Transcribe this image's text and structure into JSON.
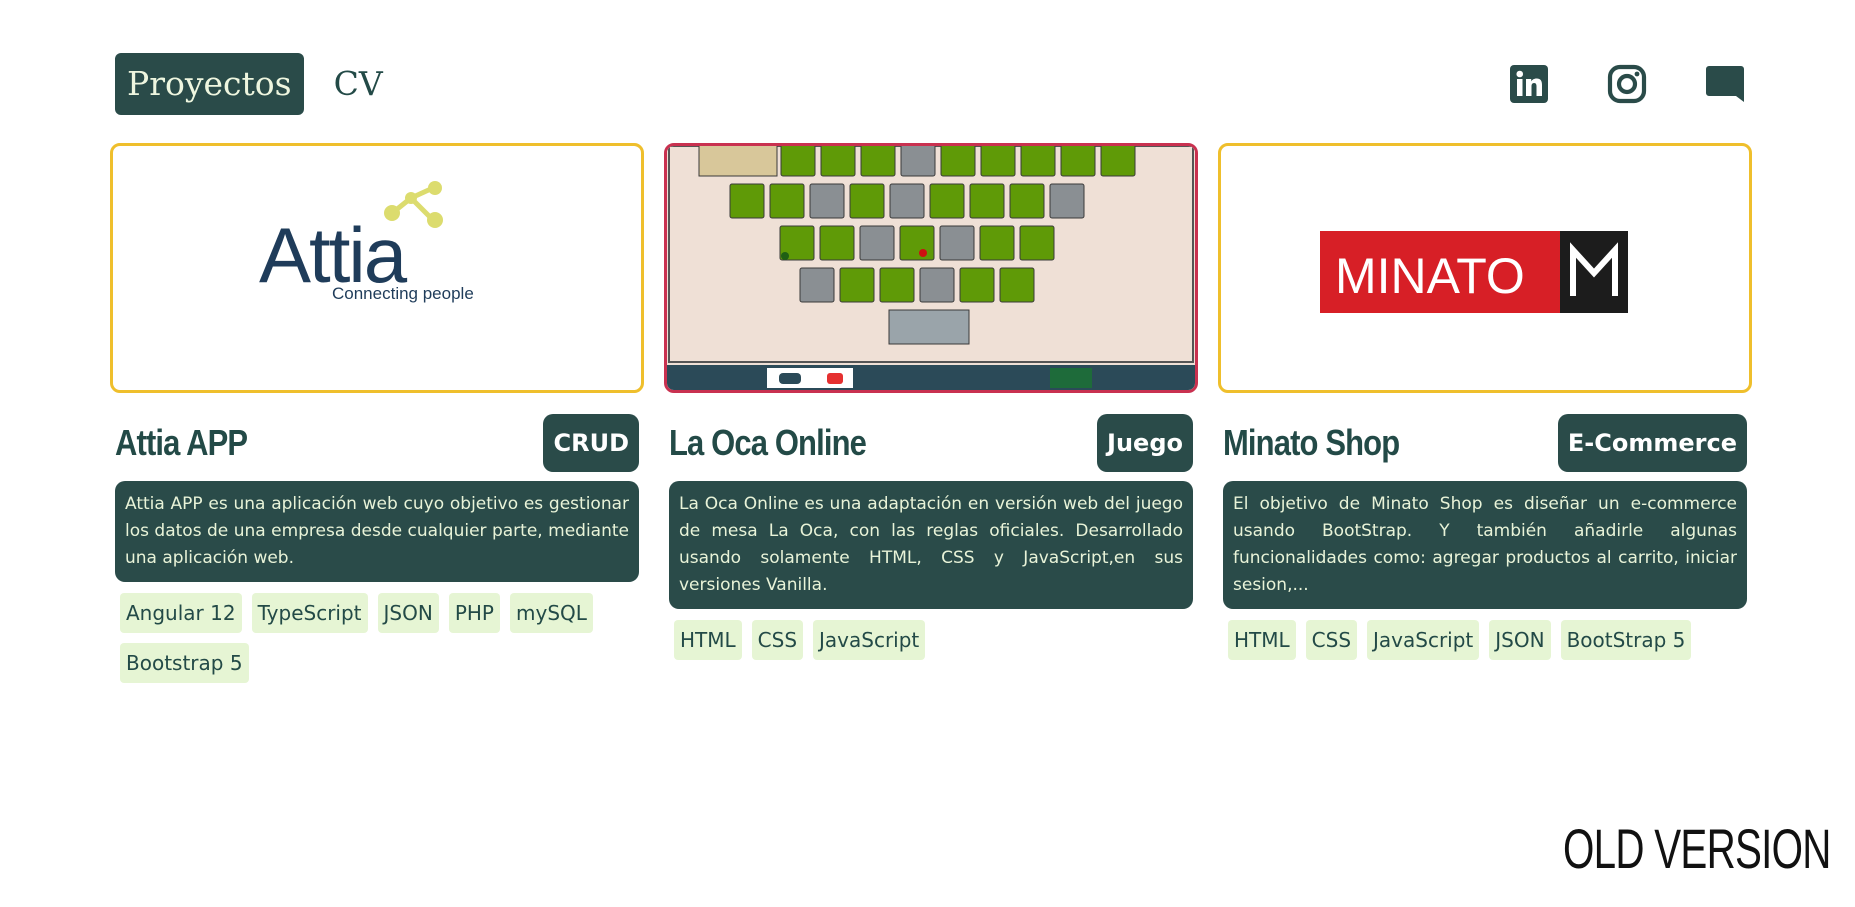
{
  "nav": {
    "items": [
      {
        "label": "Proyectos"
      },
      {
        "label": "CV"
      }
    ]
  },
  "socials": [
    "linkedin-icon",
    "instagram-icon",
    "chat-icon"
  ],
  "colors": {
    "primary": "#2a4b49",
    "tag_bg": "#e6f5d4",
    "card_border": "#efbf2c",
    "card_border_hover": "#c93150"
  },
  "projects": [
    {
      "title": "Attia APP",
      "badge": "CRUD",
      "description": "Attia APP es una aplicación web cuyo objetivo es gestionar los datos de una empresa desde cualquier parte, mediante una aplicación web.",
      "tags": [
        "Angular 12",
        "TypeScript",
        "JSON",
        "PHP",
        "mySQL",
        "Bootstrap 5"
      ],
      "logo": {
        "name": "Attia",
        "tagline": "Connecting people"
      }
    },
    {
      "title": "La Oca Online",
      "badge": "Juego",
      "description": "La Oca Online es una adaptación en versión web del juego de mesa La Oca, con las reglas oficiales. Desarrollado usando solamente HTML, CSS y JavaScript,en sus versiones Vanilla.",
      "tags": [
        "HTML",
        "CSS",
        "JavaScript"
      ]
    },
    {
      "title": "Minato Shop",
      "badge": "E-Commerce",
      "description": "El objetivo de Minato Shop es diseñar un e-commerce usando BootStrap. Y también añadirle algunas funcionalidades como: agregar productos al carrito, iniciar sesion,...",
      "tags": [
        "HTML",
        "CSS",
        "JavaScript",
        "JSON",
        "BootStrap 5"
      ],
      "logo": {
        "name": "MINATO"
      }
    }
  ],
  "old_version": "OLD VERSION"
}
